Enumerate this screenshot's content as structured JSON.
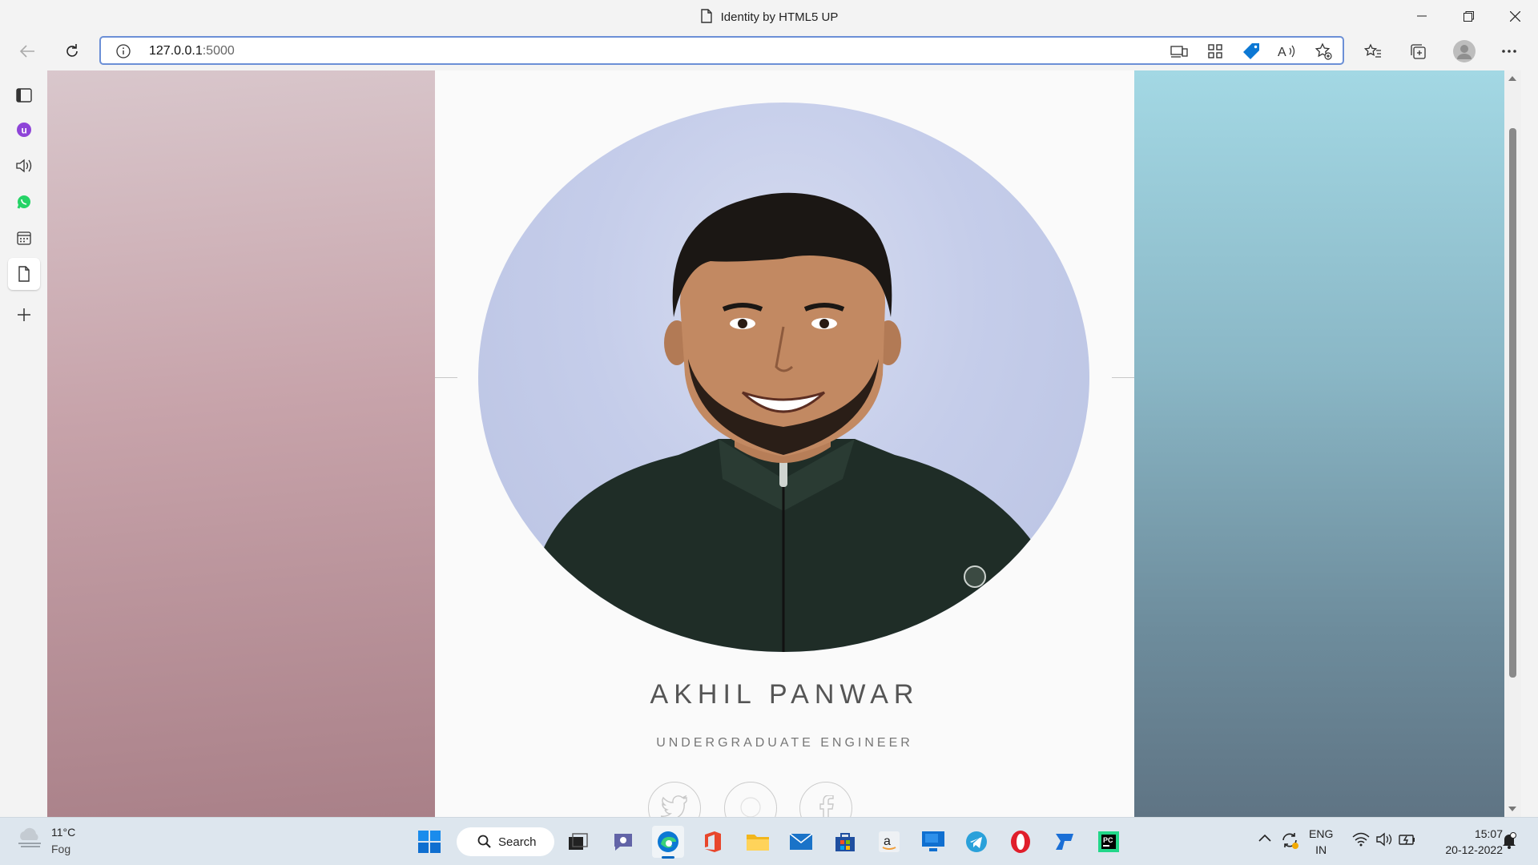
{
  "browser": {
    "window_title": "Identity by HTML5 UP",
    "address": {
      "host": "127.0.0.1",
      "port": ":5000"
    }
  },
  "page": {
    "name": "AKHIL PANWAR",
    "role": "UNDERGRADUATE ENGINEER",
    "social_icons": [
      "twitter-icon",
      "github-icon",
      "facebook-icon"
    ]
  },
  "taskbar": {
    "weather": {
      "temp": "11°C",
      "desc": "Fog"
    },
    "search_label": "Search",
    "lang": {
      "line1": "ENG",
      "line2": "IN"
    },
    "clock": {
      "time": "15:07",
      "date": "20-12-2022"
    }
  },
  "colors": {
    "accent": "#0067c0",
    "edge_blue": "#0c78d4",
    "whatsapp_green": "#25d366",
    "pycharm_green": "#21d789"
  }
}
